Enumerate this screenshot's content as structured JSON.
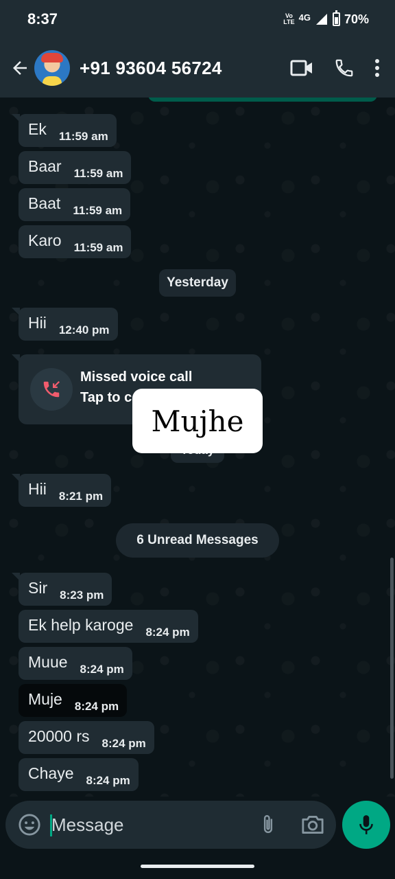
{
  "status_bar": {
    "time": "8:37",
    "volte_top": "Vo",
    "volte_bottom": "LTE",
    "network": "4G",
    "battery": "70%"
  },
  "header": {
    "contact": "+91 93604 56724",
    "icons": [
      "back-arrow-icon",
      "video-call-icon",
      "voice-call-icon",
      "more-options-icon"
    ]
  },
  "messages": [
    {
      "text": "Ek",
      "time": "11:59 am"
    },
    {
      "text": "Baar",
      "time": "11:59 am"
    },
    {
      "text": "Baat",
      "time": "11:59 am"
    },
    {
      "text": "Karo",
      "time": "11:59 am"
    },
    {
      "text": "Hii",
      "time": "12:40 pm"
    },
    {
      "text": "Hii",
      "time": "8:21 pm"
    },
    {
      "text": "Sir",
      "time": "8:23 pm"
    },
    {
      "text": "Ek help karoge",
      "time": "8:24 pm"
    },
    {
      "text": "Muue",
      "time": "8:24 pm"
    },
    {
      "text": "Muje",
      "time": "8:24 pm"
    },
    {
      "text": "20000 rs",
      "time": "8:24 pm"
    },
    {
      "text": "Chaye",
      "time": "8:24 pm"
    }
  ],
  "separators": {
    "yesterday": "Yesterday",
    "today": "Today",
    "unread": "6 Unread Messages"
  },
  "missed_call": {
    "title": "Missed voice call",
    "subtitle": "Tap to c"
  },
  "overlay": {
    "text": "Mujhe"
  },
  "composer": {
    "placeholder": "Message"
  },
  "colors": {
    "accent": "#00a884",
    "header_bg": "#1f2c33",
    "incoming_bubble": "#202c33",
    "missed_call_red": "#f15c6d"
  }
}
